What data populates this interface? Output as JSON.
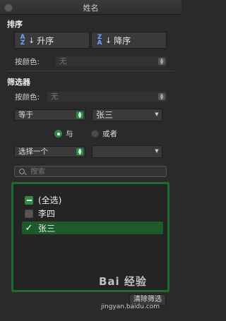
{
  "window": {
    "title": "姓名"
  },
  "sort": {
    "heading": "排序",
    "ascending_label": "升序",
    "descending_label": "降序",
    "color_label": "按颜色:",
    "color_value": "无"
  },
  "filter": {
    "heading": "筛选器",
    "color_label": "按颜色:",
    "color_value": "无",
    "condition1": {
      "operator": "等于",
      "value": "张三"
    },
    "logic": {
      "and_label": "与",
      "or_label": "或者",
      "selected": "与"
    },
    "condition2": {
      "operator": "选择一个",
      "value": ""
    }
  },
  "search": {
    "placeholder": "搜索"
  },
  "list": {
    "items": [
      {
        "label": "(全选)",
        "state": "mixed"
      },
      {
        "label": "李四",
        "state": "unchecked"
      },
      {
        "label": "张三",
        "state": "checked"
      }
    ]
  },
  "footer": {
    "clear_label": "清除筛选"
  },
  "watermark": {
    "text": "Bai 经验",
    "url": "jingyan.baidu.com"
  },
  "colors": {
    "accent_green": "#2d8a48",
    "highlight": "#1e5a2c",
    "frame_green": "#1f6b36"
  }
}
